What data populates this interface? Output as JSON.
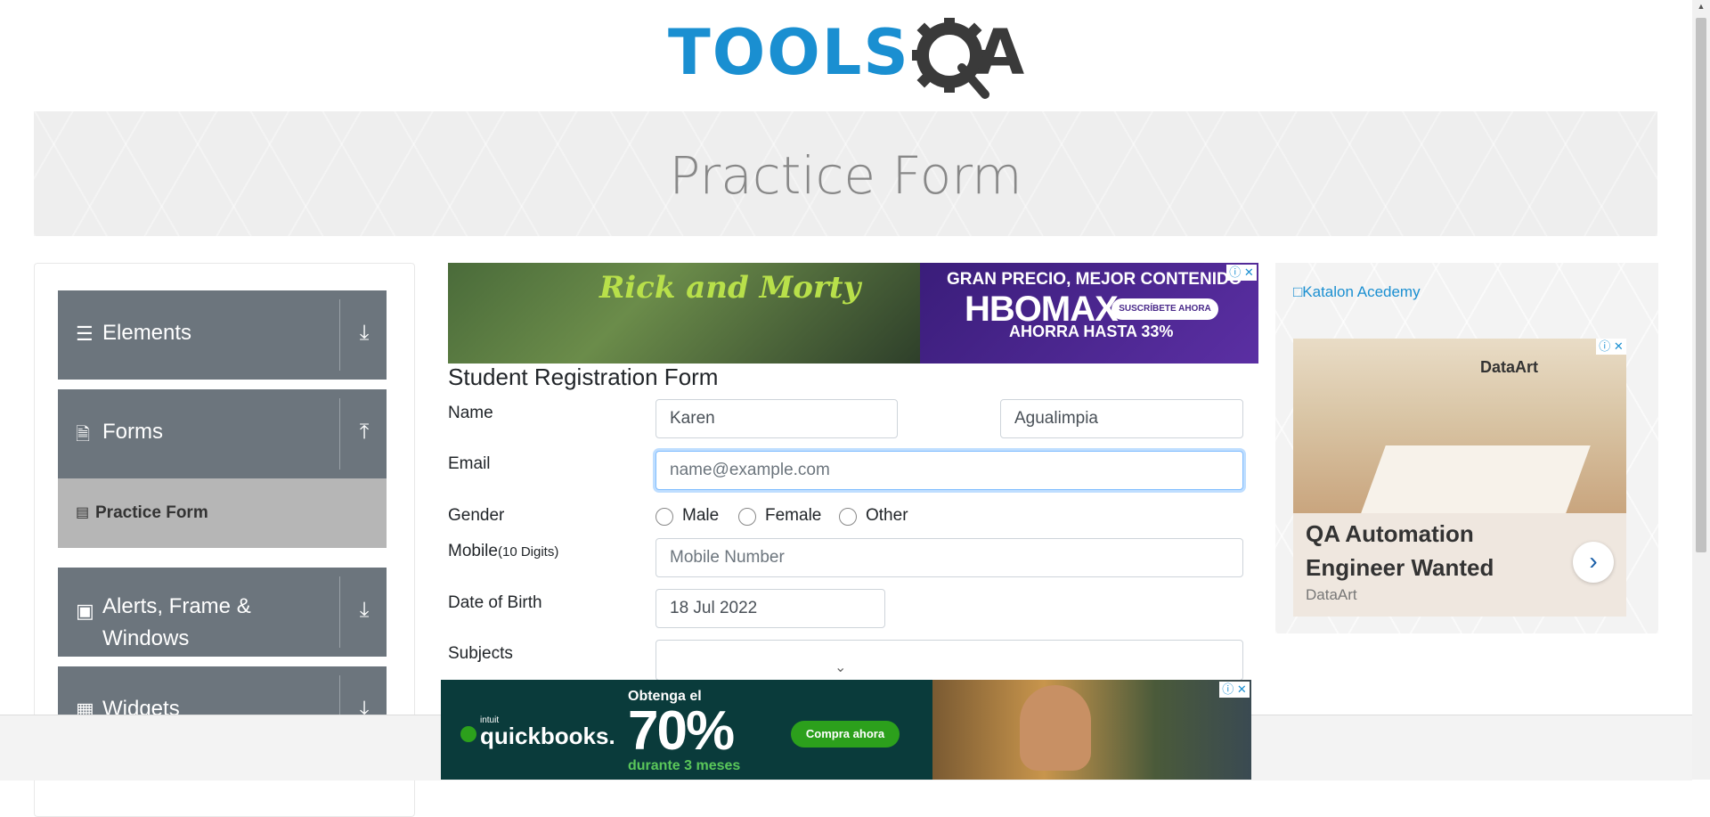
{
  "header": {
    "logo_tools": "TOOLS",
    "logo_qa": "QA",
    "page_title": "Practice Form"
  },
  "sidebar": {
    "groups": [
      {
        "label": "Elements",
        "icon": "hamburger-icon",
        "expanded": false
      },
      {
        "label": "Forms",
        "icon": "document-icon",
        "expanded": true
      },
      {
        "label": "Alerts, Frame & Windows",
        "icon": "window-icon",
        "expanded": false
      },
      {
        "label": "Widgets",
        "icon": "widgets-icon",
        "expanded": false
      }
    ],
    "active_item": "Practice Form"
  },
  "ad_top": {
    "logo": "Rick and Morty",
    "headline": "GRAN PRECIO, MEJOR CONTENIDO",
    "brand": "HBOMAX",
    "button": "SUSCRÍBETE AHORA",
    "offer": "AHORRA HASTA 33%"
  },
  "form": {
    "title": "Student Registration Form",
    "name_label": "Name",
    "first_name": "Karen",
    "last_name": "Agualimpia",
    "email_label": "Email",
    "email_placeholder": "name@example.com",
    "gender_label": "Gender",
    "gender_options": [
      "Male",
      "Female",
      "Other"
    ],
    "mobile_label": "Mobile",
    "mobile_hint": "(10 Digits)",
    "mobile_placeholder": "Mobile Number",
    "dob_label": "Date of Birth",
    "dob_value": "18 Jul 2022",
    "subjects_label": "Subjects"
  },
  "side_ad": {
    "katalon_alt": "Katalon Acedemy",
    "brand": "DataArt",
    "headline": "QA Automation Engineer Wanted",
    "advertiser": "DataArt"
  },
  "bottom_ad": {
    "intuit": "intuit",
    "brand": "quickbooks.",
    "lead": "Obtenga el",
    "percent": "70%",
    "duration": "durante 3 meses",
    "cta": "Compra ahora"
  },
  "colors": {
    "sidebar_group": "#6c757d",
    "active_item": "#b6b6b6",
    "link": "#1a8fd1",
    "focus_border": "#80bdff"
  }
}
